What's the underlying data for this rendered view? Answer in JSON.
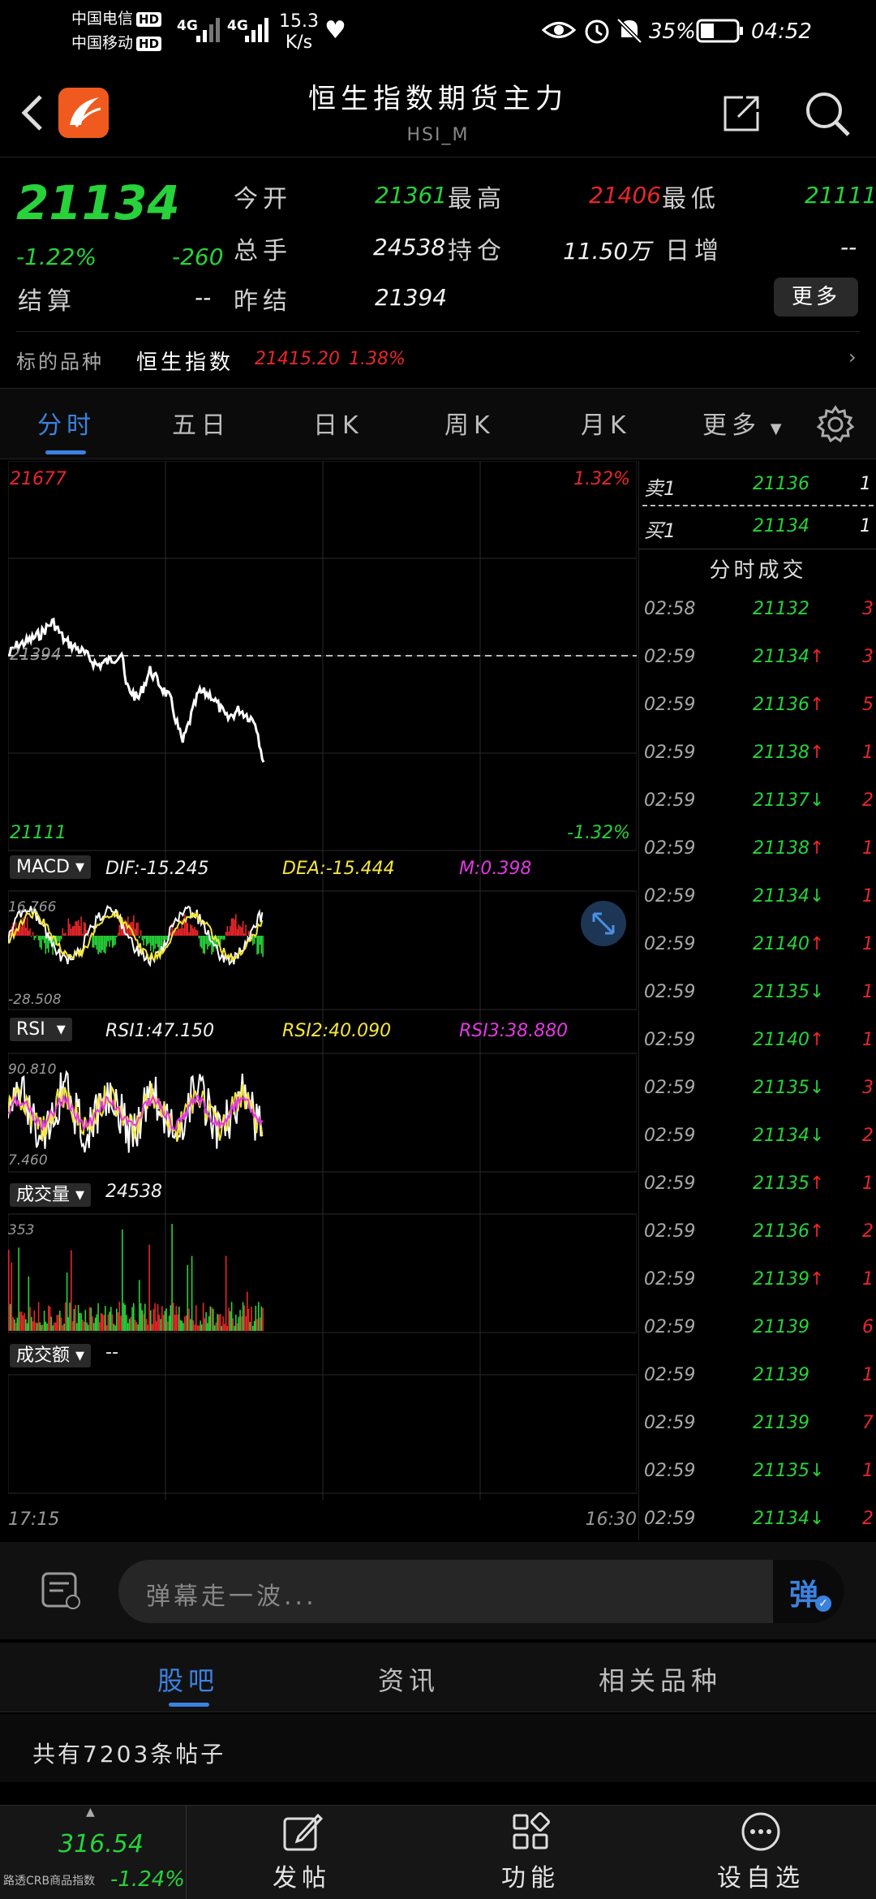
{
  "status_bar": {
    "carrier1": "中国电信",
    "carrier2": "中国移动",
    "hd": "HD",
    "net1": "4G",
    "net2": "4G",
    "speed": "15.3",
    "speed_unit": "K/s",
    "battery": "35%",
    "time": "04:52"
  },
  "header": {
    "title": "恒生指数期货主力",
    "subtitle": "HSI_M"
  },
  "quote": {
    "price": "21134",
    "change_pct": "-1.22%",
    "change": "-260",
    "open_label": "今开",
    "open_value": "21361",
    "high_label": "最高",
    "high_value": "21406",
    "low_label": "最低",
    "low_value": "21111",
    "volume_label": "总手",
    "volume_value": "24538",
    "oi_label": "持仓",
    "oi_value": "11.50万",
    "daily_inc_label": "日增",
    "daily_inc_value": "--",
    "settle_label": "结算",
    "settle_value": "--",
    "prev_settle_label": "昨结",
    "prev_settle_value": "21394",
    "more_label": "更多",
    "underlying_label": "标的品种",
    "underlying_name": "恒生指数",
    "underlying_price": "21415.20",
    "underlying_pct": "1.38%",
    "colors": {
      "up": "#e8262a",
      "down": "#27d23a"
    }
  },
  "tabs": [
    "分时",
    "五日",
    "日K",
    "周K",
    "月K",
    "更多"
  ],
  "chart": {
    "price_high": "21677",
    "price_high_pct": "1.32%",
    "price_mid": "21394",
    "price_low": "21111",
    "price_low_pct": "-1.32%",
    "macd_sel": "MACD",
    "macd_dif": "DIF:-15.245",
    "macd_dea": "DEA:-15.444",
    "macd_m": "M:0.398",
    "macd_top": "16.766",
    "macd_bottom": "-28.508",
    "rsi_sel": "RSI",
    "rsi1": "RSI1:47.150",
    "rsi2": "RSI2:40.090",
    "rsi3": "RSI3:38.880",
    "rsi_top": "90.810",
    "rsi_bottom": "7.460",
    "vol_sel": "成交量",
    "vol_value": "24538",
    "vol_top": "353",
    "amt_sel": "成交额",
    "amt_value": "--",
    "time_start": "17:15",
    "time_end": "16:30"
  },
  "book": {
    "ask_label": "卖1",
    "ask_price": "21136",
    "ask_vol": "1",
    "bid_label": "买1",
    "bid_price": "21134",
    "bid_vol": "1",
    "trades_title": "分时成交"
  },
  "trades": [
    {
      "t": "02:58",
      "p": "21132",
      "dir": "",
      "v": "3"
    },
    {
      "t": "02:59",
      "p": "21134",
      "dir": "up",
      "v": "3"
    },
    {
      "t": "02:59",
      "p": "21136",
      "dir": "up",
      "v": "5"
    },
    {
      "t": "02:59",
      "p": "21138",
      "dir": "up",
      "v": "1"
    },
    {
      "t": "02:59",
      "p": "21137",
      "dir": "down",
      "v": "2"
    },
    {
      "t": "02:59",
      "p": "21138",
      "dir": "up",
      "v": "1"
    },
    {
      "t": "02:59",
      "p": "21134",
      "dir": "down",
      "v": "1"
    },
    {
      "t": "02:59",
      "p": "21140",
      "dir": "up",
      "v": "1"
    },
    {
      "t": "02:59",
      "p": "21135",
      "dir": "down",
      "v": "1"
    },
    {
      "t": "02:59",
      "p": "21140",
      "dir": "up",
      "v": "1"
    },
    {
      "t": "02:59",
      "p": "21135",
      "dir": "down",
      "v": "3"
    },
    {
      "t": "02:59",
      "p": "21134",
      "dir": "down",
      "v": "2"
    },
    {
      "t": "02:59",
      "p": "21135",
      "dir": "up",
      "v": "1"
    },
    {
      "t": "02:59",
      "p": "21136",
      "dir": "up",
      "v": "2"
    },
    {
      "t": "02:59",
      "p": "21139",
      "dir": "up",
      "v": "1"
    },
    {
      "t": "02:59",
      "p": "21139",
      "dir": "",
      "v": "6"
    },
    {
      "t": "02:59",
      "p": "21139",
      "dir": "",
      "v": "1"
    },
    {
      "t": "02:59",
      "p": "21139",
      "dir": "",
      "v": "7"
    },
    {
      "t": "02:59",
      "p": "21135",
      "dir": "down",
      "v": "1"
    },
    {
      "t": "02:59",
      "p": "21134",
      "dir": "down",
      "v": "2"
    }
  ],
  "danmaku": {
    "placeholder": "弹幕走一波...",
    "send_label": "弹"
  },
  "subtabs": [
    "股吧",
    "资讯",
    "相关品种"
  ],
  "post_count": "共有7203条帖子",
  "bottom_nav": {
    "index_price": "316.54",
    "index_name": "路透CRB商品指数",
    "index_pct": "-1.24%",
    "post_label": "发帖",
    "func_label": "功能",
    "watch_label": "设自选"
  }
}
